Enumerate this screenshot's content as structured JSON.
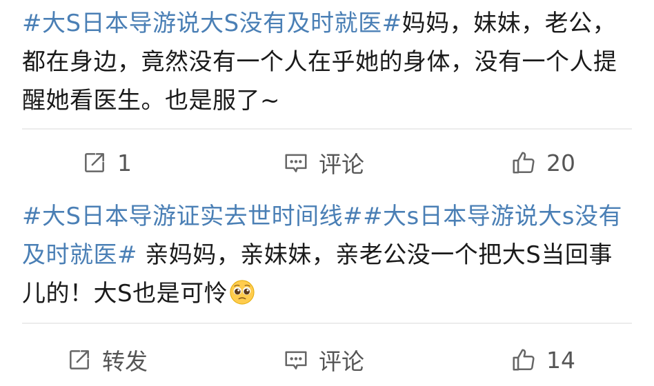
{
  "posts": [
    {
      "topic_1": "#大S日本导游说大S没有及时就医#",
      "text": "妈妈，妹妹，老公，都在身边，竟然没有一个人在乎她的身体，没有一个人提醒她看医生。也是服了~",
      "actions": {
        "repost_label": "1",
        "comment_label": "评论",
        "like_label": "20"
      }
    },
    {
      "topic_1": "#大S日本导游证实去世时间线#",
      "topic_2": "#大s日本导游说大s没有及时就医#",
      "text": " 亲妈妈，亲妹妹，亲老公没一个把大S当回事儿的！大S也是可怜",
      "emoji_icon": "pleading-face-emoji",
      "actions": {
        "repost_label": "转发",
        "comment_label": "评论",
        "like_label": "14"
      }
    }
  ],
  "colors": {
    "topic": "#4a7fb5",
    "text": "#1a1a1a",
    "action": "#555555",
    "divider": "#ececec"
  }
}
